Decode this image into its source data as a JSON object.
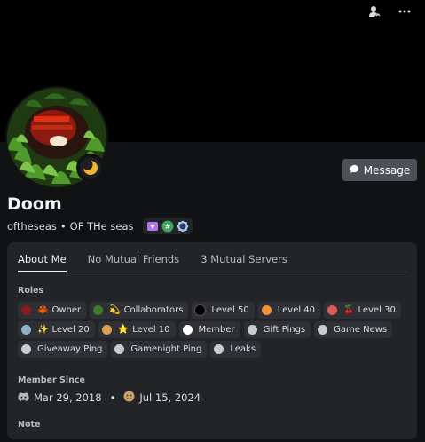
{
  "top_icons": [
    "user-status-icon",
    "more-icon"
  ],
  "user": {
    "display_name": "Doom",
    "username": "oftheseas",
    "separator": "•",
    "pronouns": "OF THe seas"
  },
  "message_button": {
    "label": "Message"
  },
  "badges": [
    "nitro-badge-icon",
    "hypesquad-badge-icon",
    "boost-badge-icon"
  ],
  "tabs": [
    {
      "label": "About Me",
      "active": true
    },
    {
      "label": "No Mutual Friends",
      "active": false
    },
    {
      "label": "3 Mutual Servers",
      "active": false
    }
  ],
  "roles_section": {
    "title": "Roles",
    "items": [
      {
        "label": "Owner",
        "color": "#8b1a1a",
        "emoji": "🦀"
      },
      {
        "label": "Collaborators",
        "color": "#3d7a2a",
        "emoji": "💫"
      },
      {
        "label": "Level 50",
        "color": "#000000",
        "emoji": ""
      },
      {
        "label": "Level 40",
        "color": "#f0923a",
        "emoji": ""
      },
      {
        "label": "Level 30",
        "color": "#e05a5a",
        "emoji": "🍒"
      },
      {
        "label": "Level 20",
        "color": "#8fb3cc",
        "emoji": "✨"
      },
      {
        "label": "Level 10",
        "color": "#d9a14e",
        "emoji": "⭐"
      },
      {
        "label": "Member",
        "color": "#ffffff",
        "emoji": ""
      },
      {
        "label": "Gift Pings",
        "color": "#c9cbce",
        "emoji": ""
      },
      {
        "label": "Game News",
        "color": "#c9cbce",
        "emoji": ""
      },
      {
        "label": "Giveaway Ping",
        "color": "#c9cbce",
        "emoji": ""
      },
      {
        "label": "Gamenight Ping",
        "color": "#c9cbce",
        "emoji": ""
      },
      {
        "label": "Leaks",
        "color": "#c9cbce",
        "emoji": ""
      }
    ]
  },
  "member_since": {
    "title": "Member Since",
    "discord_date": "Mar 29, 2018",
    "separator": "•",
    "server_date": "Jul 15, 2024"
  },
  "note": {
    "title": "Note"
  }
}
